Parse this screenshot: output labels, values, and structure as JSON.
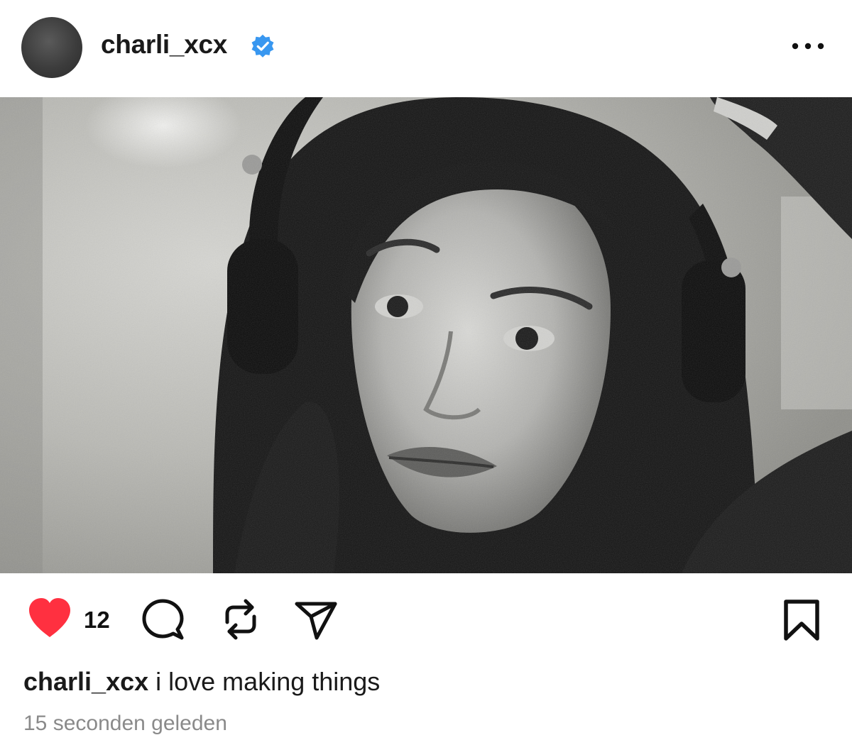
{
  "post": {
    "username": "charli_xcx",
    "verified": true,
    "like_count": "12",
    "caption_user": "charli_xcx",
    "caption_text": " i love making things",
    "timestamp": "15 seconden geleden"
  },
  "colors": {
    "like_red": "#ff3040",
    "verified_blue": "#3897f0",
    "text_primary": "#1a1a1a",
    "text_muted": "#8a8a8a"
  },
  "icons": {
    "more": "more-options-icon",
    "like": "heart-icon",
    "comment": "comment-bubble-icon",
    "repost": "repost-arrows-icon",
    "share": "paper-plane-icon",
    "save": "bookmark-icon",
    "verified": "verified-badge-icon"
  }
}
